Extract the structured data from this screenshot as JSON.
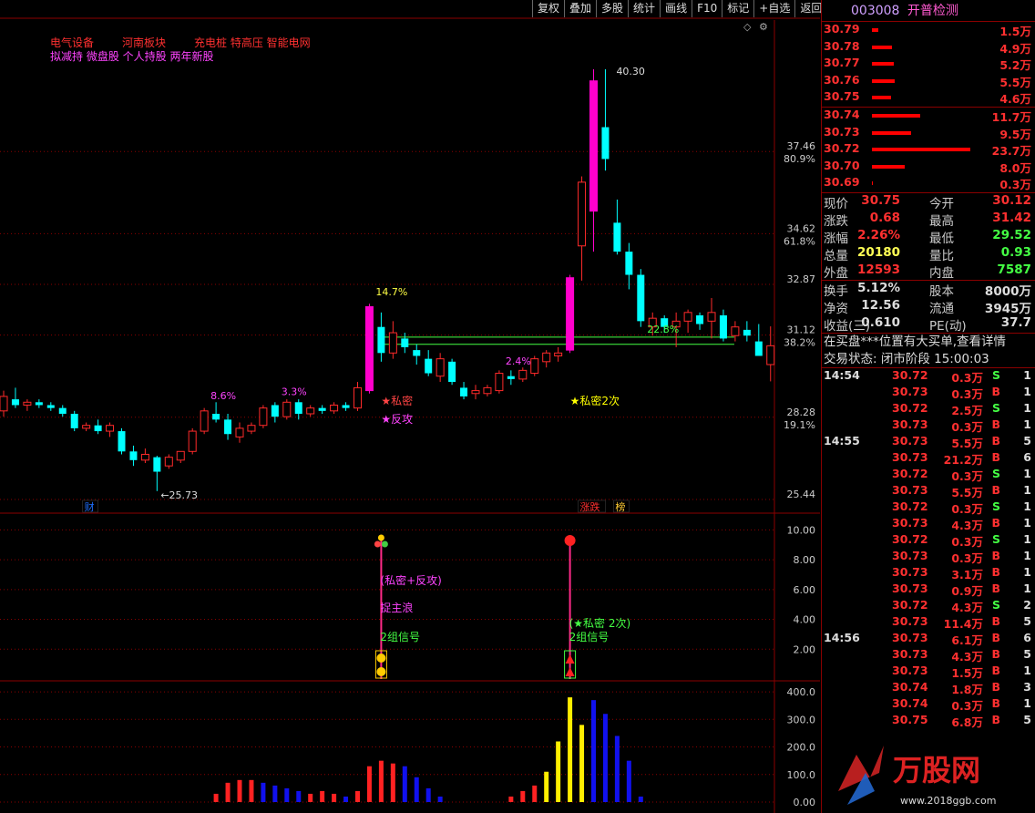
{
  "toolbar": [
    "复权",
    "叠加",
    "多股",
    "统计",
    "画线",
    "F10",
    "标记",
    "+自选",
    "返回"
  ],
  "stock": {
    "code": "003008",
    "name": "开普检测"
  },
  "concepts": {
    "row1": [
      "电气设备",
      "河南板块",
      "充电桩 特高压 智能电网"
    ],
    "row2": "拟减持 微盘股 个人持股 两年新股"
  },
  "chart_data": [
    {
      "type": "candlestick",
      "title": "",
      "y_axis": {
        "ticks": [
          {
            "price": "37.46",
            "pct": "80.9%"
          },
          {
            "price": "34.62",
            "pct": "61.8%"
          },
          {
            "price": "32.87",
            "pct": ""
          },
          {
            "price": "31.12",
            "pct": "38.2%"
          },
          {
            "price": "28.28",
            "pct": "19.1%"
          },
          {
            "price": "25.44",
            "pct": ""
          }
        ]
      },
      "ylim": [
        25.0,
        42.0
      ],
      "high_label": "40.30",
      "low_label": "25.73",
      "candles": [
        [
          28.5,
          29.2,
          28.3,
          29.0
        ],
        [
          28.9,
          29.3,
          28.6,
          28.7
        ],
        [
          28.7,
          28.9,
          28.5,
          28.8
        ],
        [
          28.8,
          28.9,
          28.6,
          28.7
        ],
        [
          28.7,
          28.8,
          28.5,
          28.6
        ],
        [
          28.6,
          28.7,
          28.3,
          28.4
        ],
        [
          28.4,
          28.5,
          27.8,
          27.9
        ],
        [
          27.9,
          28.1,
          27.8,
          28.0
        ],
        [
          28.0,
          28.2,
          27.7,
          27.8
        ],
        [
          27.8,
          28.1,
          27.6,
          28.0
        ],
        [
          27.8,
          27.9,
          27.0,
          27.1
        ],
        [
          27.1,
          27.3,
          26.6,
          26.8
        ],
        [
          26.8,
          27.2,
          26.7,
          27.0
        ],
        [
          26.9,
          26.95,
          25.73,
          26.4
        ],
        [
          26.6,
          27.0,
          26.5,
          26.9
        ],
        [
          26.8,
          27.0,
          26.7,
          27.1
        ],
        [
          27.1,
          27.9,
          27.0,
          27.8
        ],
        [
          27.8,
          28.6,
          27.7,
          28.5
        ],
        [
          28.4,
          28.8,
          28.1,
          28.2
        ],
        [
          28.2,
          28.4,
          27.5,
          27.7
        ],
        [
          27.6,
          28.1,
          27.4,
          27.9
        ],
        [
          27.8,
          28.1,
          27.7,
          28.0
        ],
        [
          28.0,
          28.7,
          27.9,
          28.6
        ],
        [
          28.7,
          28.8,
          28.1,
          28.3
        ],
        [
          28.3,
          28.9,
          28.2,
          28.8
        ],
        [
          28.8,
          28.9,
          28.2,
          28.4
        ],
        [
          28.4,
          28.7,
          28.3,
          28.6
        ],
        [
          28.6,
          28.7,
          28.4,
          28.5
        ],
        [
          28.5,
          28.8,
          28.4,
          28.7
        ],
        [
          28.7,
          28.8,
          28.5,
          28.6
        ],
        [
          28.6,
          29.5,
          28.5,
          29.3
        ],
        [
          29.2,
          32.2,
          29.1,
          32.1
        ],
        [
          31.4,
          31.9,
          30.2,
          30.5
        ],
        [
          30.5,
          31.6,
          30.3,
          31.2
        ],
        [
          31.0,
          31.2,
          30.5,
          30.7
        ],
        [
          30.6,
          30.8,
          30.1,
          30.4
        ],
        [
          30.3,
          30.6,
          29.7,
          29.8
        ],
        [
          29.7,
          30.5,
          29.5,
          30.3
        ],
        [
          30.2,
          30.3,
          29.4,
          29.5
        ],
        [
          29.3,
          29.5,
          28.9,
          29.0
        ],
        [
          29.1,
          29.4,
          28.9,
          29.2
        ],
        [
          29.1,
          29.4,
          29.0,
          29.3
        ],
        [
          29.2,
          29.9,
          29.1,
          29.8
        ],
        [
          29.7,
          29.9,
          29.4,
          29.6
        ],
        [
          29.6,
          30.0,
          29.5,
          29.9
        ],
        [
          29.8,
          30.4,
          29.7,
          30.3
        ],
        [
          30.2,
          30.6,
          30.0,
          30.5
        ],
        [
          30.4,
          30.7,
          30.2,
          30.5
        ],
        [
          30.6,
          33.2,
          30.5,
          33.1
        ],
        [
          34.2,
          36.6,
          33.0,
          36.4
        ],
        [
          35.4,
          40.3,
          34.0,
          39.9
        ],
        [
          38.3,
          40.3,
          36.8,
          37.2
        ],
        [
          35.0,
          35.8,
          33.9,
          34.0
        ],
        [
          34.0,
          34.3,
          32.7,
          33.2
        ],
        [
          33.2,
          33.4,
          31.4,
          31.6
        ],
        [
          31.4,
          31.9,
          31.1,
          31.7
        ],
        [
          31.7,
          31.8,
          31.2,
          31.4
        ],
        [
          31.4,
          31.9,
          30.7,
          31.6
        ],
        [
          31.6,
          32.0,
          31.2,
          31.9
        ],
        [
          31.8,
          31.9,
          31.3,
          31.5
        ],
        [
          31.6,
          32.4,
          31.0,
          31.9
        ],
        [
          31.8,
          32.0,
          30.9,
          31.0
        ],
        [
          31.1,
          31.6,
          30.9,
          31.4
        ],
        [
          31.3,
          31.6,
          30.9,
          31.1
        ],
        [
          30.9,
          31.5,
          30.5,
          30.4
        ],
        [
          30.1,
          31.42,
          29.52,
          30.75
        ]
      ],
      "percent_labels": [
        {
          "idx": 18,
          "text": "8.6%",
          "color": "#ff44ff",
          "price": 28.9
        },
        {
          "idx": 24,
          "text": "3.3%",
          "color": "#ff44ff",
          "price": 29.05
        },
        {
          "idx": 32,
          "text": "14.7%",
          "color": "#ffff44",
          "price": 32.5
        },
        {
          "idx": 43,
          "text": "2.4%",
          "color": "#ff44ff",
          "price": 30.1
        },
        {
          "idx": 55,
          "text": "22.8%",
          "color": "#44ff44",
          "price": 31.2
        }
      ],
      "signals": [
        {
          "idx": 32,
          "line1": "★私密",
          "line2": "★反攻"
        },
        {
          "idx": 48,
          "line1": "★私密2次",
          "line2": ""
        }
      ],
      "support_lines": [
        31.05,
        30.8
      ],
      "badges": [
        {
          "text": "财",
          "idx": 7
        },
        {
          "text": "涨跌",
          "idx": 49
        },
        {
          "text": "榜",
          "idx": 52
        }
      ]
    },
    {
      "type": "indicator",
      "y_axis": [
        "10.00",
        "8.00",
        "6.00",
        "4.00",
        "2.00"
      ],
      "ylim": [
        0,
        11
      ],
      "signals": [
        {
          "idx": 32,
          "text": [
            "(私密+反攻)",
            "捉主浪",
            "2组信号"
          ],
          "colors": [
            "#ff44ff",
            "#ff44ff",
            "#44ff44"
          ]
        },
        {
          "idx": 48,
          "text": [
            "(★私密 2次)",
            "2组信号"
          ],
          "colors": [
            "#44ff44",
            "#44ff44"
          ]
        }
      ]
    },
    {
      "type": "bar",
      "y_axis": [
        "400.0",
        "300.0",
        "200.0",
        "100.0",
        "0.00"
      ],
      "ylim": [
        0,
        430
      ],
      "bars": [
        {
          "idx": 18,
          "v": 30,
          "c": "red"
        },
        {
          "idx": 19,
          "v": 70,
          "c": "red"
        },
        {
          "idx": 20,
          "v": 80,
          "c": "red"
        },
        {
          "idx": 21,
          "v": 80,
          "c": "red"
        },
        {
          "idx": 22,
          "v": 70,
          "c": "blue"
        },
        {
          "idx": 23,
          "v": 60,
          "c": "blue"
        },
        {
          "idx": 24,
          "v": 50,
          "c": "blue"
        },
        {
          "idx": 25,
          "v": 40,
          "c": "blue"
        },
        {
          "idx": 26,
          "v": 30,
          "c": "red"
        },
        {
          "idx": 27,
          "v": 40,
          "c": "red"
        },
        {
          "idx": 28,
          "v": 30,
          "c": "red"
        },
        {
          "idx": 29,
          "v": 20,
          "c": "blue"
        },
        {
          "idx": 30,
          "v": 40,
          "c": "red"
        },
        {
          "idx": 31,
          "v": 130,
          "c": "red"
        },
        {
          "idx": 32,
          "v": 150,
          "c": "red"
        },
        {
          "idx": 33,
          "v": 140,
          "c": "red"
        },
        {
          "idx": 34,
          "v": 130,
          "c": "blue"
        },
        {
          "idx": 35,
          "v": 90,
          "c": "blue"
        },
        {
          "idx": 36,
          "v": 50,
          "c": "blue"
        },
        {
          "idx": 37,
          "v": 20,
          "c": "blue"
        },
        {
          "idx": 43,
          "v": 20,
          "c": "red"
        },
        {
          "idx": 44,
          "v": 40,
          "c": "red"
        },
        {
          "idx": 45,
          "v": 60,
          "c": "red"
        },
        {
          "idx": 46,
          "v": 110,
          "c": "yellow"
        },
        {
          "idx": 47,
          "v": 220,
          "c": "yellow"
        },
        {
          "idx": 48,
          "v": 380,
          "c": "yellow"
        },
        {
          "idx": 49,
          "v": 280,
          "c": "yellow"
        },
        {
          "idx": 50,
          "v": 370,
          "c": "blue"
        },
        {
          "idx": 51,
          "v": 320,
          "c": "blue"
        },
        {
          "idx": 52,
          "v": 240,
          "c": "blue"
        },
        {
          "idx": 53,
          "v": 150,
          "c": "blue"
        },
        {
          "idx": 54,
          "v": 20,
          "c": "blue"
        }
      ]
    }
  ],
  "order_book": {
    "asks": [
      {
        "p": "30.79",
        "v": "1.5万",
        "w": 1.5
      },
      {
        "p": "30.78",
        "v": "4.9万",
        "w": 4.9
      },
      {
        "p": "30.77",
        "v": "5.2万",
        "w": 5.2
      },
      {
        "p": "30.76",
        "v": "5.5万",
        "w": 5.5
      },
      {
        "p": "30.75",
        "v": "4.6万",
        "w": 4.6
      }
    ],
    "bids": [
      {
        "p": "30.74",
        "v": "11.7万",
        "w": 11.7
      },
      {
        "p": "30.73",
        "v": "9.5万",
        "w": 9.5
      },
      {
        "p": "30.72",
        "v": "23.7万",
        "w": 23.7
      },
      {
        "p": "30.70",
        "v": "8.0万",
        "w": 8.0
      },
      {
        "p": "30.69",
        "v": "0.3万",
        "w": 0.3
      }
    ]
  },
  "quote": [
    {
      "l": "现价",
      "v": "30.75",
      "vc": "#ff3030",
      "l2": "今开",
      "v2": "30.12",
      "v2c": "#ff3030"
    },
    {
      "l": "涨跌",
      "v": "0.68",
      "vc": "#ff3030",
      "l2": "最高",
      "v2": "31.42",
      "v2c": "#ff3030"
    },
    {
      "l": "涨幅",
      "v": "2.26%",
      "vc": "#ff3030",
      "l2": "最低",
      "v2": "29.52",
      "v2c": "#44ff44"
    },
    {
      "l": "总量",
      "v": "20180",
      "vc": "#ffff55",
      "l2": "量比",
      "v2": "0.93",
      "v2c": "#44ff44"
    },
    {
      "l": "外盘",
      "v": "12593",
      "vc": "#ff3030",
      "l2": "内盘",
      "v2": "7587",
      "v2c": "#44ff44"
    }
  ],
  "quote2": [
    {
      "l": "换手",
      "v": "5.12%",
      "vc": "#dddddd",
      "l2": "股本",
      "v2": "8000万",
      "v2c": "#dddddd"
    },
    {
      "l": "净资",
      "v": "12.56",
      "vc": "#dddddd",
      "l2": "流通",
      "v2": "3945万",
      "v2c": "#dddddd"
    },
    {
      "l": "收益(三)",
      "v": "0.610",
      "vc": "#dddddd",
      "l2": "PE(动)",
      "v2": "37.7",
      "v2c": "#dddddd"
    }
  ],
  "notice": "在买盘***位置有大买单,查看详情",
  "trade_status": "交易状态: 闭市阶段 15:00:03",
  "ticks": [
    {
      "t": "14:54",
      "p": "30.72",
      "v": "0.3万",
      "d": "S",
      "n": "1"
    },
    {
      "t": "",
      "p": "30.73",
      "v": "0.3万",
      "d": "B",
      "n": "1"
    },
    {
      "t": "",
      "p": "30.72",
      "v": "2.5万",
      "d": "S",
      "n": "1"
    },
    {
      "t": "",
      "p": "30.73",
      "v": "0.3万",
      "d": "B",
      "n": "1"
    },
    {
      "t": "14:55",
      "p": "30.73",
      "v": "5.5万",
      "d": "B",
      "n": "5"
    },
    {
      "t": "",
      "p": "30.73",
      "v": "21.2万",
      "d": "B",
      "n": "6"
    },
    {
      "t": "",
      "p": "30.72",
      "v": "0.3万",
      "d": "S",
      "n": "1"
    },
    {
      "t": "",
      "p": "30.73",
      "v": "5.5万",
      "d": "B",
      "n": "1"
    },
    {
      "t": "",
      "p": "30.72",
      "v": "0.3万",
      "d": "S",
      "n": "1"
    },
    {
      "t": "",
      "p": "30.73",
      "v": "4.3万",
      "d": "B",
      "n": "1"
    },
    {
      "t": "",
      "p": "30.72",
      "v": "0.3万",
      "d": "S",
      "n": "1"
    },
    {
      "t": "",
      "p": "30.73",
      "v": "0.3万",
      "d": "B",
      "n": "1"
    },
    {
      "t": "",
      "p": "30.73",
      "v": "3.1万",
      "d": "B",
      "n": "1"
    },
    {
      "t": "",
      "p": "30.73",
      "v": "0.9万",
      "d": "B",
      "n": "1"
    },
    {
      "t": "",
      "p": "30.72",
      "v": "4.3万",
      "d": "S",
      "n": "2"
    },
    {
      "t": "",
      "p": "30.73",
      "v": "11.4万",
      "d": "B",
      "n": "5"
    },
    {
      "t": "14:56",
      "p": "30.73",
      "v": "6.1万",
      "d": "B",
      "n": "6"
    },
    {
      "t": "",
      "p": "30.73",
      "v": "4.3万",
      "d": "B",
      "n": "5"
    },
    {
      "t": "",
      "p": "30.73",
      "v": "1.5万",
      "d": "B",
      "n": "1"
    },
    {
      "t": "",
      "p": "30.74",
      "v": "1.8万",
      "d": "B",
      "n": "3"
    },
    {
      "t": "",
      "p": "30.74",
      "v": "0.3万",
      "d": "B",
      "n": "1"
    },
    {
      "t": "",
      "p": "30.75",
      "v": "6.8万",
      "d": "B",
      "n": "5"
    }
  ],
  "watermark": {
    "text": "万股网",
    "url": "www.2018ggb.com"
  },
  "colors": {
    "up": "#ff2a2a",
    "down": "#00ffff",
    "magenta": "#ff00cc",
    "grid": "#8b0000",
    "green": "#44ff44",
    "yellow": "#ffff00",
    "blue": "#0000ee"
  }
}
